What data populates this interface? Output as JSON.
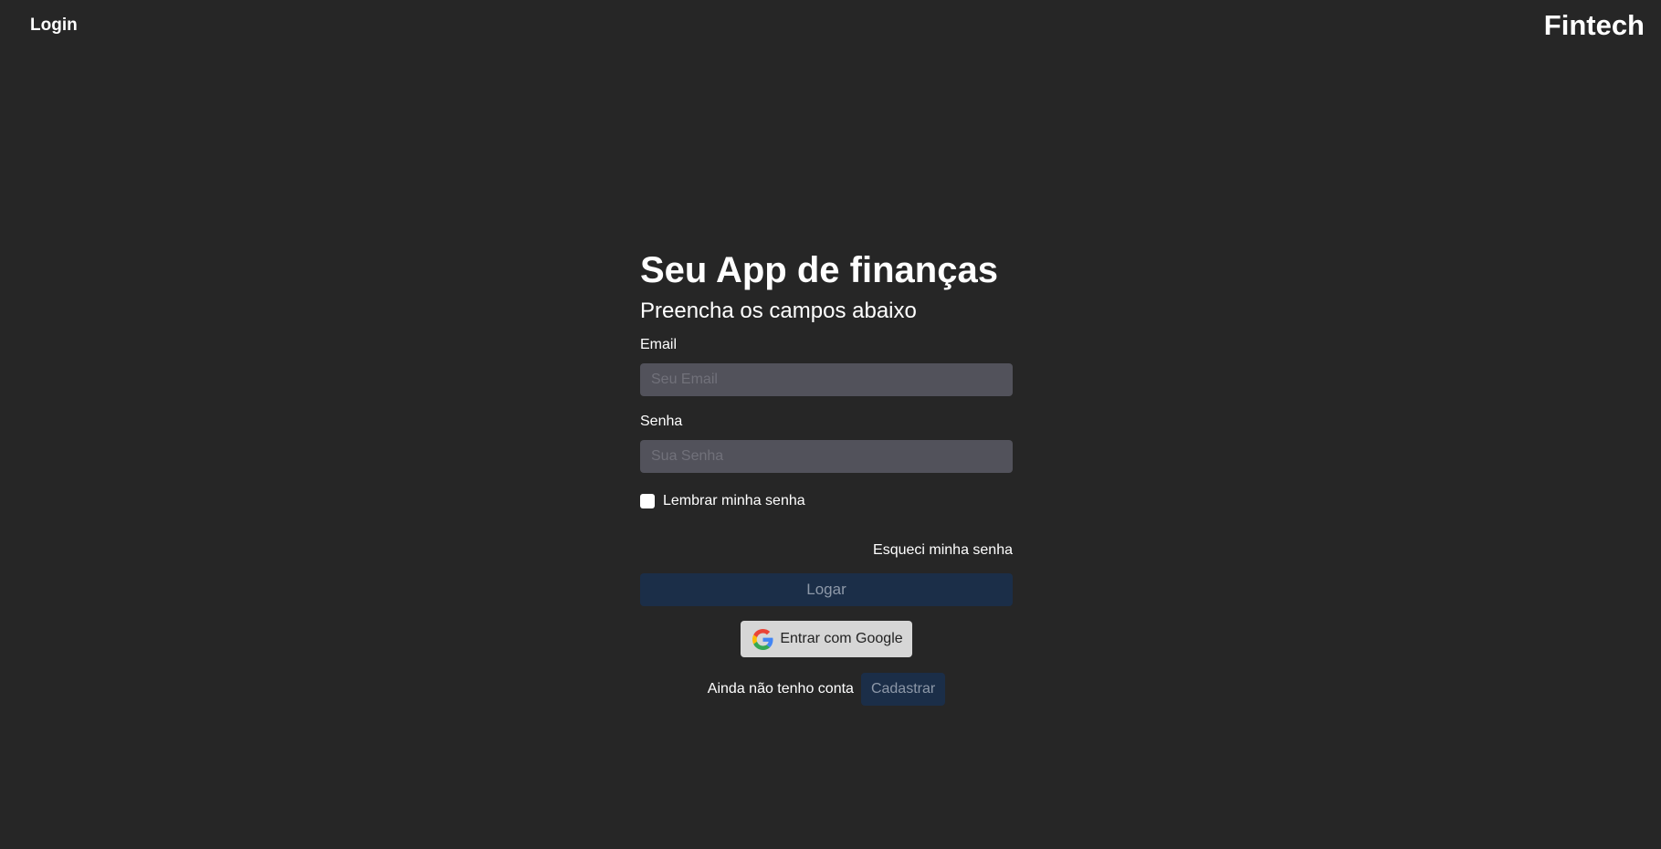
{
  "header": {
    "nav_login_label": "Login",
    "brand": "Fintech"
  },
  "form": {
    "title": "Seu App de finanças",
    "subtitle": "Preencha os campos abaixo",
    "email": {
      "label": "Email",
      "placeholder": "Seu Email",
      "value": ""
    },
    "password": {
      "label": "Senha",
      "placeholder": "Sua Senha",
      "value": ""
    },
    "remember": {
      "label": "Lembrar minha senha",
      "checked": false
    },
    "forgot_label": "Esqueci minha senha",
    "submit_label": "Logar",
    "google": {
      "label": "Entrar com Google",
      "icon": "google-icon"
    },
    "signup": {
      "prompt": "Ainda não tenho conta",
      "button_label": "Cadastrar"
    }
  },
  "colors": {
    "background": "#262626",
    "input_background": "#52525b",
    "primary_button": "#1b2e48",
    "primary_button_text": "#8d98a8",
    "google_button": "#d6d6d6",
    "text": "#ffffff"
  }
}
